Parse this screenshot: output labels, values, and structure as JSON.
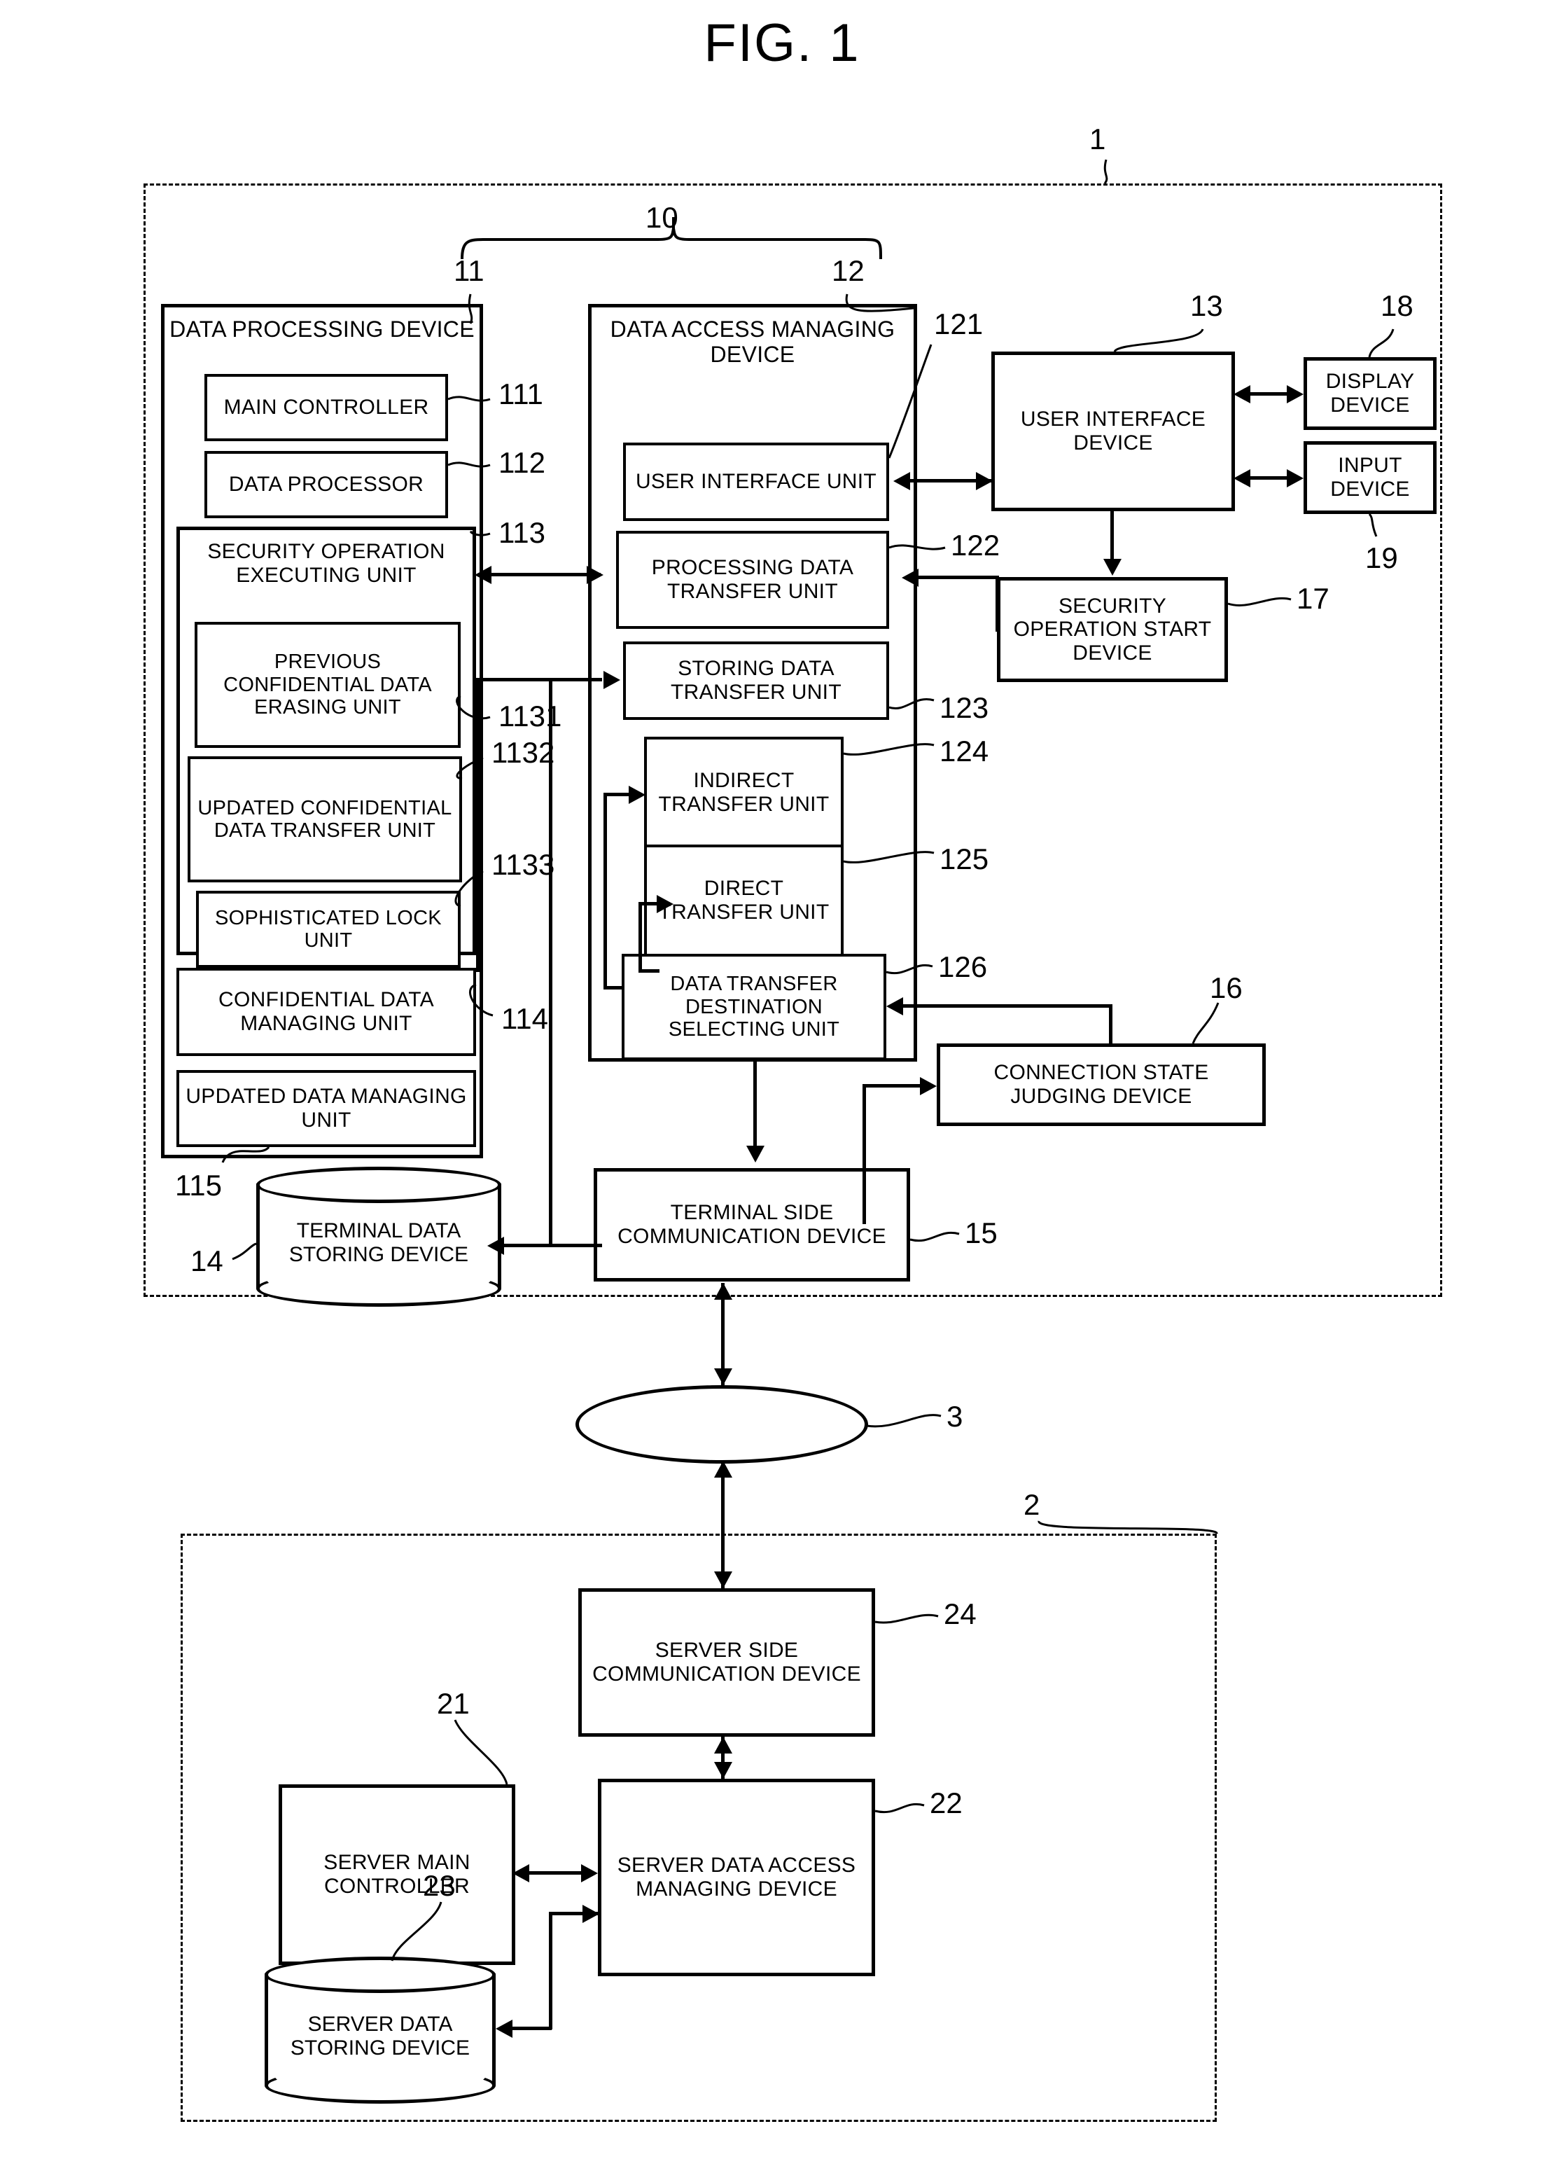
{
  "figure": {
    "title": "FIG. 1"
  },
  "terminal": {
    "ref": "1",
    "group_ref": "10",
    "data_processing_device": {
      "ref": "11",
      "label": "DATA PROCESSING DEVICE",
      "units": [
        {
          "ref": "111",
          "label": "MAIN CONTROLLER"
        },
        {
          "ref": "112",
          "label": "DATA PROCESSOR"
        }
      ],
      "security_operation_executing_unit": {
        "ref": "113",
        "label": "SECURITY OPERATION EXECUTING UNIT",
        "units": [
          {
            "ref": "1131",
            "label": "PREVIOUS CONFIDENTIAL DATA ERASING UNIT"
          },
          {
            "ref": "1132",
            "label": "UPDATED CONFIDENTIAL DATA TRANSFER UNIT"
          },
          {
            "ref": "1133",
            "label": "SOPHISTICATED LOCK UNIT"
          }
        ]
      },
      "managing_units": [
        {
          "ref": "114",
          "label": "CONFIDENTIAL DATA MANAGING UNIT"
        },
        {
          "ref": "115",
          "label": "UPDATED DATA MANAGING UNIT"
        }
      ]
    },
    "data_access_managing_device": {
      "ref": "12",
      "label": "DATA ACCESS MANAGING DEVICE",
      "units": [
        {
          "ref": "121",
          "label": "USER INTERFACE UNIT"
        },
        {
          "ref": "122",
          "label": "PROCESSING DATA TRANSFER UNIT"
        },
        {
          "ref": "123",
          "label": "STORING DATA TRANSFER UNIT"
        },
        {
          "ref": "124",
          "label": "INDIRECT TRANSFER UNIT"
        },
        {
          "ref": "125",
          "label": "DIRECT TRANSFER UNIT"
        },
        {
          "ref": "126",
          "label": "DATA TRANSFER DESTINATION SELECTING UNIT"
        }
      ]
    },
    "user_interface_device": {
      "ref": "13",
      "label": "USER INTERFACE DEVICE"
    },
    "display_device": {
      "ref": "18",
      "label": "DISPLAY DEVICE"
    },
    "input_device": {
      "ref": "19",
      "label": "INPUT DEVICE"
    },
    "security_operation_start_device": {
      "ref": "17",
      "label": "SECURITY OPERATION START DEVICE"
    },
    "connection_state_judging_device": {
      "ref": "16",
      "label": "CONNECTION STATE JUDGING DEVICE"
    },
    "terminal_data_storing_device": {
      "ref": "14",
      "label": "TERMINAL DATA STORING DEVICE"
    },
    "terminal_side_communication_device": {
      "ref": "15",
      "label": "TERMINAL SIDE COMMUNICATION DEVICE"
    }
  },
  "network": {
    "ref": "3"
  },
  "server": {
    "ref": "2",
    "server_side_communication_device": {
      "ref": "24",
      "label": "SERVER SIDE COMMUNICATION DEVICE"
    },
    "server_main_controller": {
      "ref": "21",
      "label": "SERVER MAIN CONTROLLER"
    },
    "server_data_access_managing_device": {
      "ref": "22",
      "label": "SERVER DATA ACCESS MANAGING DEVICE"
    },
    "server_data_storing_device": {
      "ref": "23",
      "label": "SERVER DATA STORING DEVICE"
    }
  }
}
